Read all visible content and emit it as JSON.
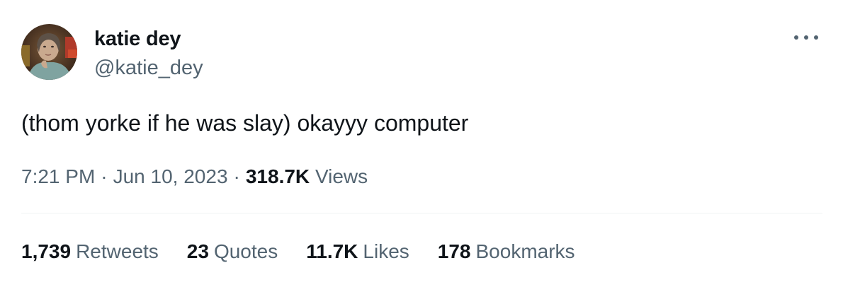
{
  "author": {
    "display_name": "katie dey",
    "handle": "@katie_dey"
  },
  "menu": {
    "icon": "more-horizontal-icon"
  },
  "tweet": {
    "text": "(thom yorke if he was slay) okayyy computer",
    "time": "7:21 PM",
    "date": "Jun 10, 2023",
    "separator": "·",
    "views_count": "318.7K",
    "views_label": "Views"
  },
  "stats": {
    "retweets_count": "1,739",
    "retweets_label": "Retweets",
    "quotes_count": "23",
    "quotes_label": "Quotes",
    "likes_count": "11.7K",
    "likes_label": "Likes",
    "bookmarks_count": "178",
    "bookmarks_label": "Bookmarks"
  },
  "colors": {
    "text_primary": "#0f1419",
    "text_secondary": "#536471",
    "divider": "#eff3f4",
    "background": "#ffffff"
  }
}
